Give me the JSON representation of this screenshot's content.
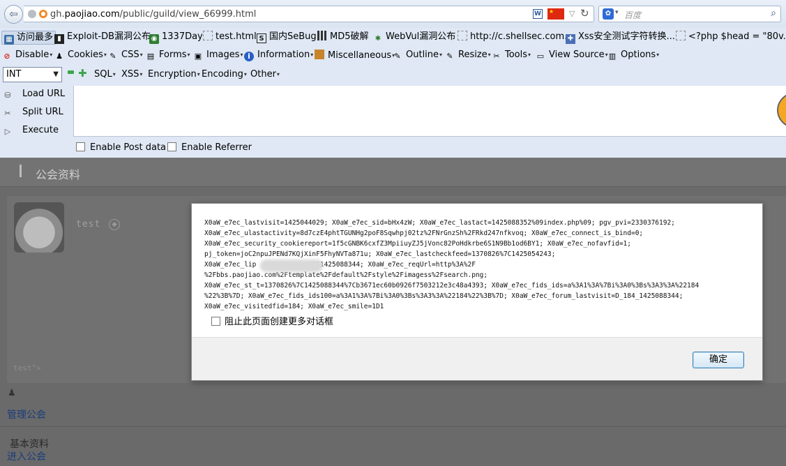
{
  "navbar": {
    "url_prefix": "gh.",
    "url_domain": "paojiao.com",
    "url_path": "/public/guild/view_66999.html",
    "search_placeholder": "百度"
  },
  "bookmarks": [
    {
      "label": "访问最多",
      "icon": "grid-icon"
    },
    {
      "label": "Exploit-DB漏洞公布",
      "icon": "db-icon"
    },
    {
      "label": "1337Day",
      "icon": "1337-icon"
    },
    {
      "label": "test.html",
      "icon": "page-icon"
    },
    {
      "label": "国内SeBug",
      "icon": "s-icon"
    },
    {
      "label": "MD5破解",
      "icon": "grid-icon"
    },
    {
      "label": "WebVul漏洞公布",
      "icon": "bug-icon"
    },
    {
      "label": "http://c.shellsec.com...",
      "icon": "page-icon"
    },
    {
      "label": "Xss安全测试字符转换...",
      "icon": "puzzle-icon"
    },
    {
      "label": "<?php $head = \"80v...",
      "icon": "page-icon"
    }
  ],
  "toolbar1": {
    "disable": "Disable",
    "cookies": "Cookies",
    "css": "CSS",
    "forms": "Forms",
    "images": "Images",
    "information": "Information",
    "miscellaneous": "Miscellaneous",
    "outline": "Outline",
    "resize": "Resize",
    "tools": "Tools",
    "view_source": "View Source",
    "options": "Options"
  },
  "toolbar2": {
    "int_select": "INT",
    "sql": "SQL",
    "xss": "XSS",
    "encryption": "Encryption",
    "encoding": "Encoding",
    "other": "Other"
  },
  "hackbar": {
    "load_url": "Load URL",
    "split_url": "Split URL",
    "execute": "Execute",
    "enable_post": "Enable Post data",
    "enable_referrer": "Enable Referrer"
  },
  "page": {
    "title": "公会资料",
    "username": "test",
    "payload_text": "test\">",
    "manage_guild": "管理公会",
    "basic_info": "基本资料",
    "enter_guild": "进入公会"
  },
  "dialog": {
    "message_lines": [
      "X0aW_e7ec_lastvisit=1425044029; X0aW_e7ec_sid=bHx4zW; X0aW_e7ec_lastact=1425088352%09index.php%09; pgv_pvi=2330376192;",
      "X0aW_e7ec_ulastactivity=8d7czE4phtTGUNHg2poF8Sqwhpj02tz%2FNrGnzSh%2FRkd247nfkvoq; X0aW_e7ec_connect_is_bind=0;",
      "X0aW_e7ec_security_cookiereport=1f5cGNBK6cxfZ3MpiiuyZJ5jVonc82PoHdkrbe6S1N9Bb1od6BY1; X0aW_e7ec_nofavfid=1;",
      "pj_token=joC2npuJPENd7KQjXinF5FhyNVTa871u; X0aW_e7ec_lastcheckfeed=1370826%7C1425054243;",
      "X0aW_e7ec_lip              2C1425088344; X0aW_e7ec_reqUrl=http%3A%2F",
      "%2Fbbs.paojiao.com%2Ftemplate%2Fdefault%2Fstyle%2Fimagess%2Fsearch.png;",
      "X0aW_e7ec_st_t=1370826%7C1425088344%7Cb3671ec60b0926f7503212e3c48a4393; X0aW_e7ec_fids_ids=a%3A1%3A%7Bi%3A0%3Bs%3A3%3A%22184",
      "%22%3B%7D; X0aW_e7ec_fids_ids100=a%3A1%3A%7Bi%3A0%3Bs%3A3%3A%22184%22%3B%7D; X0aW_e7ec_forum_lastvisit=D_184_1425088344;",
      "X0aW_e7ec_visitedfid=184; X0aW_e7ec_smile=1D1"
    ],
    "prevent_more": "阻止此页面创建更多对话框",
    "ok": "确定"
  }
}
